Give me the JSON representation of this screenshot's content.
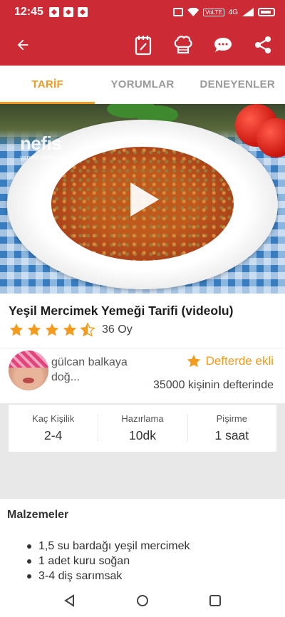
{
  "status_bar": {
    "time": "12:45",
    "network": "4G",
    "lte": "VoLTE"
  },
  "toolbar": {
    "back_icon": "arrow-left-icon",
    "actions": [
      "notepad-icon",
      "chef-hat-icon",
      "chat-bubble-icon",
      "share-icon"
    ]
  },
  "tabs": [
    {
      "label": "TARİF",
      "active": true
    },
    {
      "label": "YORUMLAR",
      "active": false
    },
    {
      "label": "DENEYENLER",
      "active": false
    }
  ],
  "hero": {
    "brand": "nefis",
    "brand_sub": "yemek tarifleri",
    "play_icon": "play-icon"
  },
  "recipe": {
    "title": "Yeşil Mercimek Yemeği Tarifi (videolu)",
    "rating_stars": 4.5,
    "rating_count": "36 Oy",
    "author": "gülcan balkaya doğ...",
    "favorite_label": "Defterde ekli",
    "favorite_count": "35000 kişinin defterinde"
  },
  "stats": [
    {
      "label": "Kaç Kişilik",
      "value": "2-4"
    },
    {
      "label": "Hazırlama",
      "value": "10dk"
    },
    {
      "label": "Pişirme",
      "value": "1 saat"
    }
  ],
  "ingredients": {
    "title": "Malzemeler",
    "items": [
      "1,5 su bardağı yeşil mercimek",
      "1 adet kuru soğan",
      "3-4 diş sarımsak"
    ]
  },
  "colors": {
    "primary": "#cc2b36",
    "accent": "#f29b1f"
  }
}
